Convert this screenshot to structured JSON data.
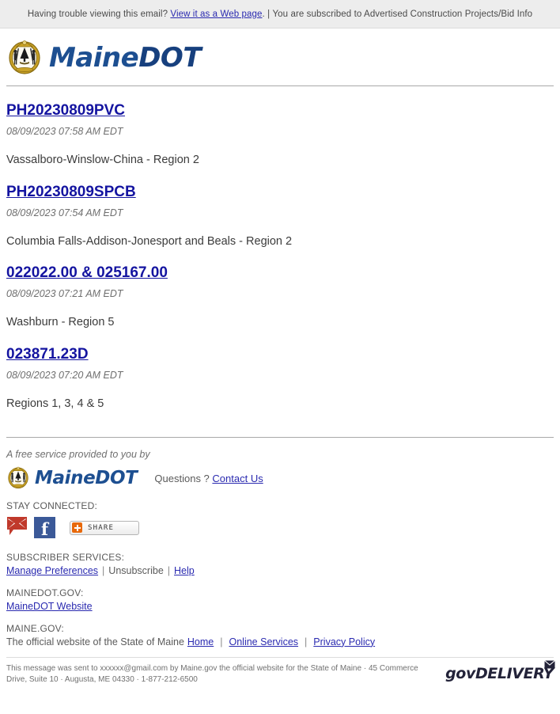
{
  "preheader": {
    "lead": "Having trouble viewing this email?",
    "web_link": "View it as a Web page",
    "period": ".",
    "separator": "|",
    "subscription": "You are subscribed to Advertised Construction Projects/Bid Info"
  },
  "masthead": {
    "wordmark_maine": "Maine",
    "wordmark_dot": "DOT",
    "seal_alt": "Maine state seal"
  },
  "articles": [
    {
      "title": "PH20230809PVC",
      "date": "08/09/2023 07:58 AM EDT",
      "body": "Vassalboro-Winslow-China - Region 2"
    },
    {
      "title": "PH20230809SPCB",
      "date": "08/09/2023 07:54 AM EDT",
      "body": "Columbia Falls-Addison-Jonesport and Beals - Region 2"
    },
    {
      "title": "022022.00 & 025167.00",
      "date": "08/09/2023 07:21 AM EDT",
      "body": "Washburn - Region 5"
    },
    {
      "title": "023871.23D",
      "date": "08/09/2023 07:20 AM EDT",
      "body": "Regions 1, 3, 4 & 5"
    }
  ],
  "footer": {
    "free_service": "A free service provided to you by",
    "wordmark_maine": "Maine",
    "wordmark_dot": "DOT",
    "questions_label": "Questions ?",
    "contact_us": "Contact Us",
    "stay_connected_label": "STAY CONNECTED:",
    "email_icon_name": "email-icon",
    "facebook_icon_name": "facebook-icon",
    "facebook_glyph": "f",
    "share_label": "SHARE",
    "subscriber_services_label": "SUBSCRIBER SERVICES:",
    "manage_preferences": "Manage Preferences",
    "unsubscribe": "Unsubscribe",
    "help": "Help",
    "mainedot_gov_label": "MAINEDOT.GOV:",
    "mainedot_website": "MaineDOT Website",
    "maine_gov_label": "MAINE.GOV:",
    "maine_gov_lead": "The official website of the State of Maine",
    "home": "Home",
    "online_services": "Online Services",
    "privacy_policy": "Privacy Policy",
    "pipe": "|"
  },
  "legal": {
    "text": "This message was sent to xxxxxx@gmail.com by Maine.gov the official website for the State of Maine · 45 Commerce Drive, Suite 10 · Augusta, ME 04330 · 1-877-212-6500",
    "govdelivery_gov": "gov",
    "govdelivery_delivery": "DELIVERY"
  },
  "colors": {
    "link": "#2a2ab0",
    "article_link": "#1414a0",
    "brand_blue": "#1d4f91",
    "preheader_bg": "#ededed",
    "facebook_blue": "#3b5998",
    "share_orange": "#e8690b",
    "envelope_red": "#c0392b"
  }
}
